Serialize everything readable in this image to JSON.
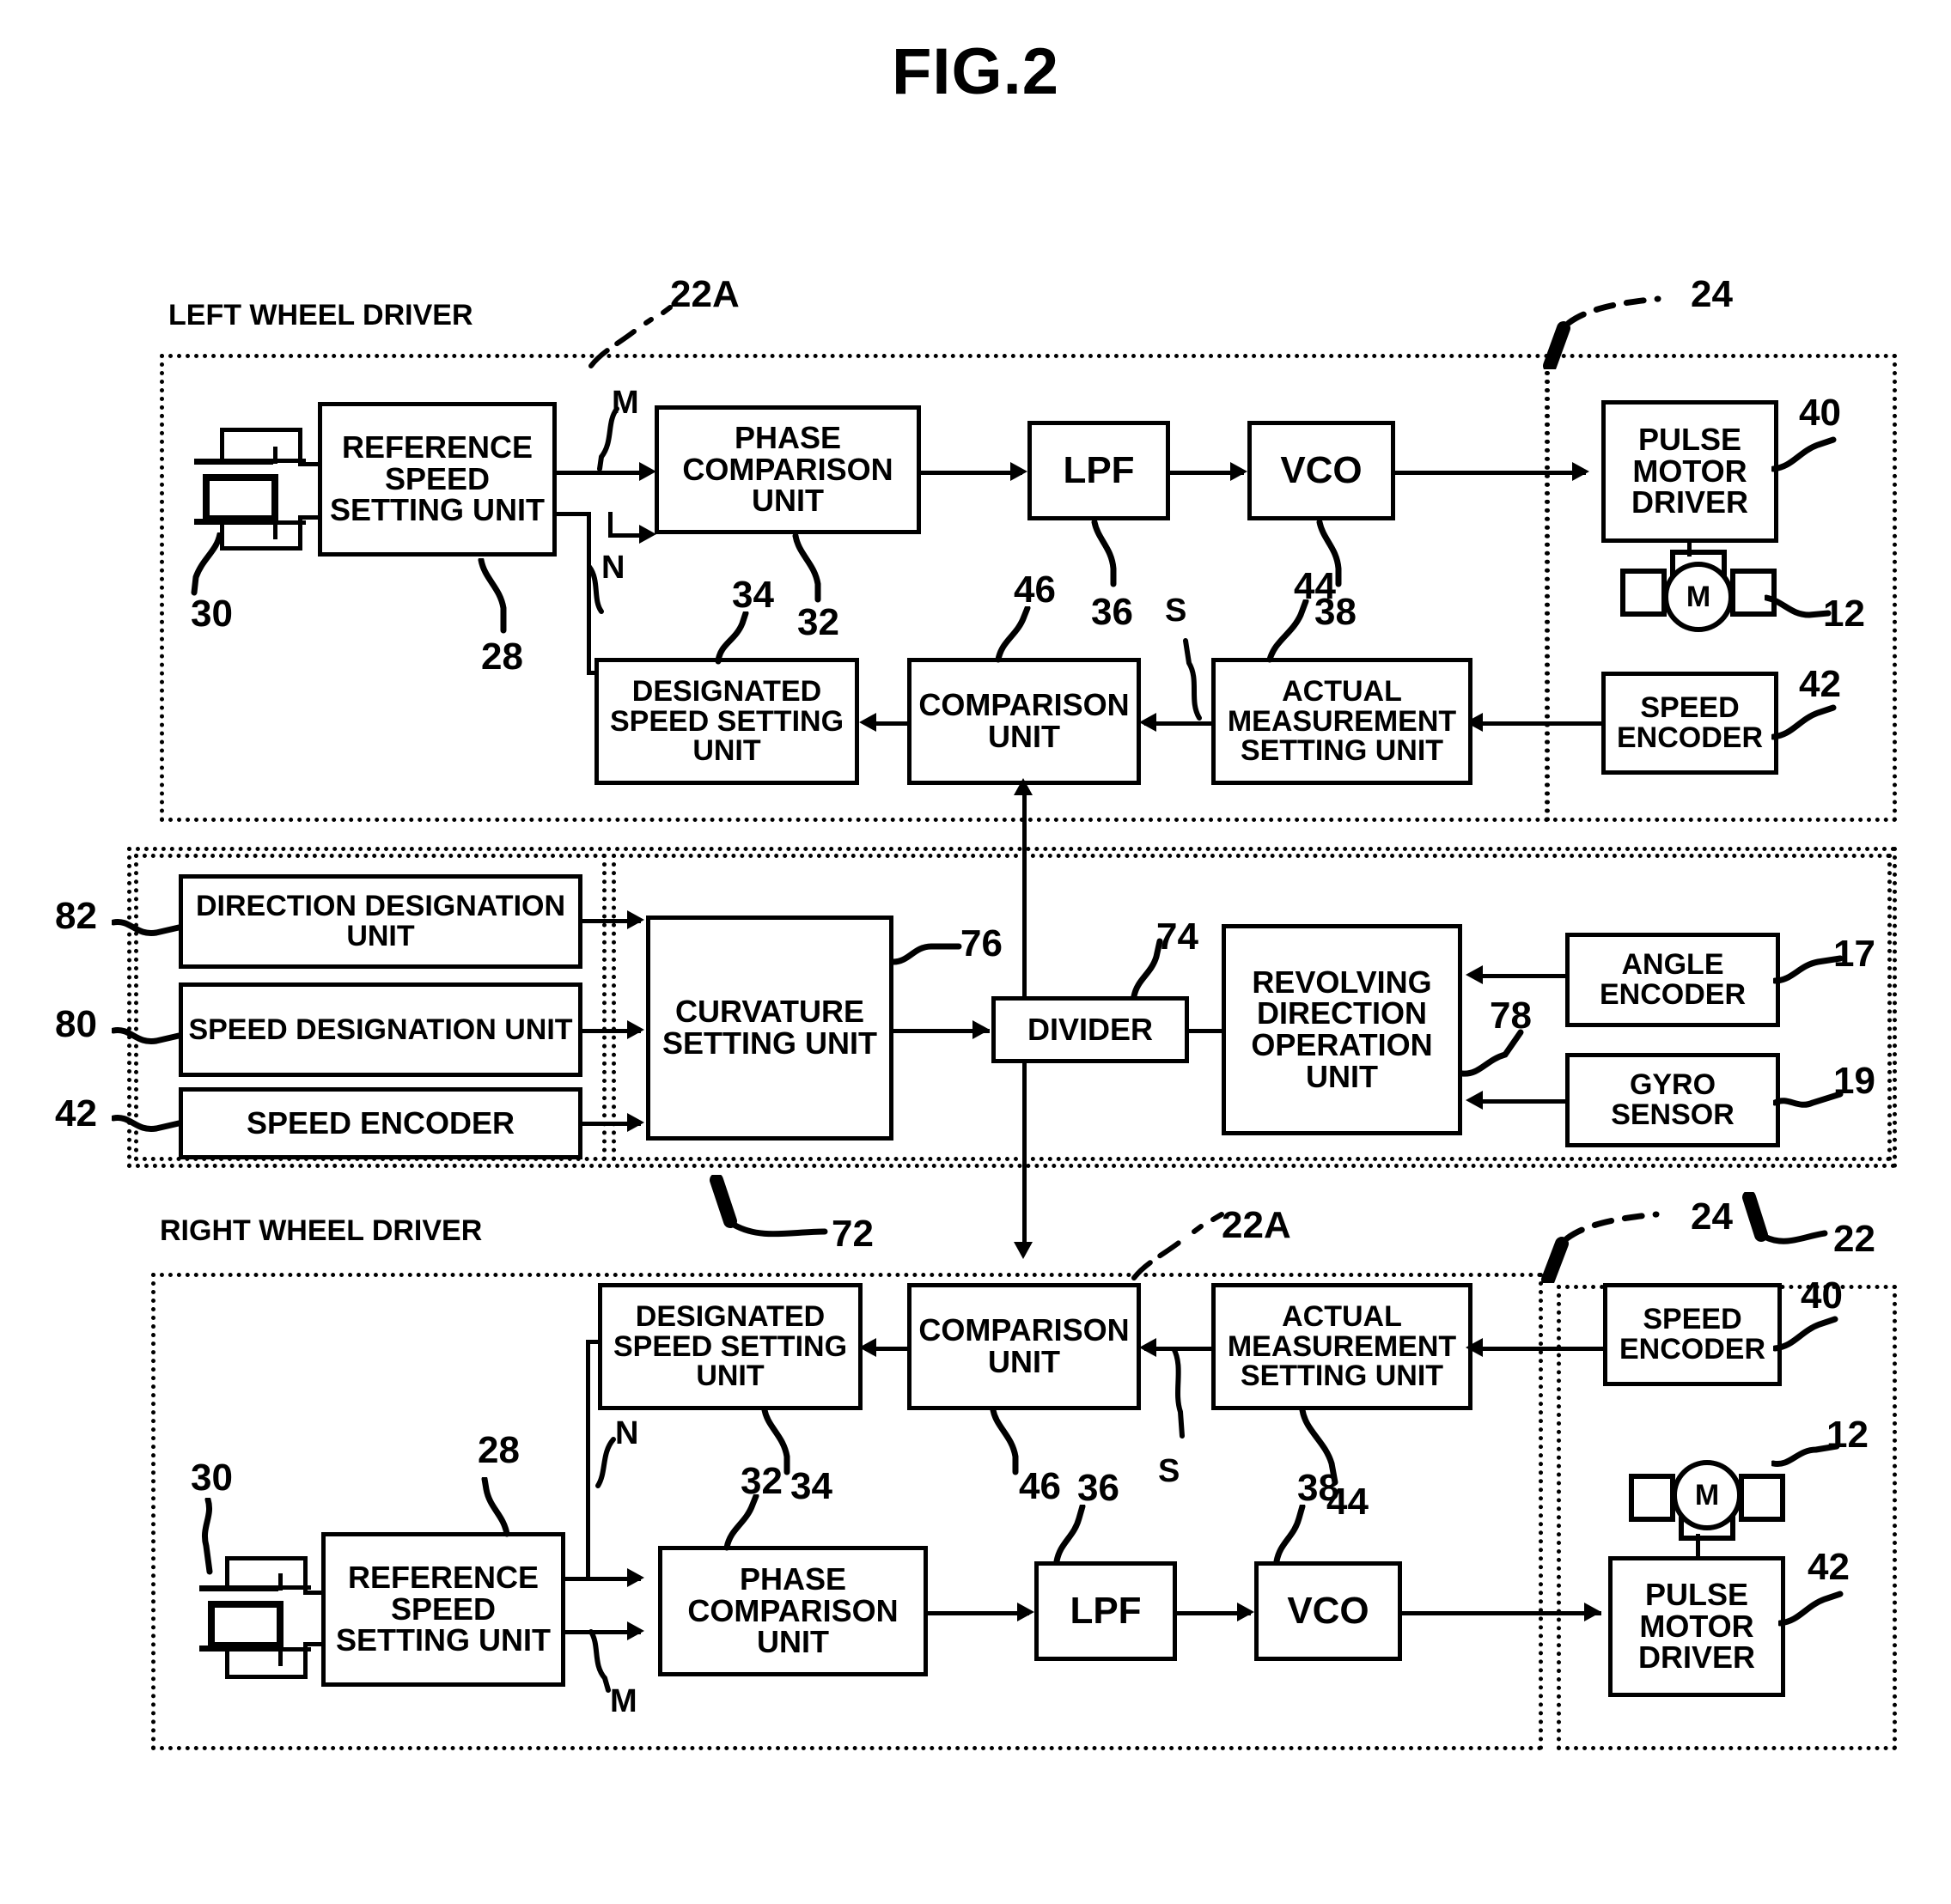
{
  "figure": {
    "title": "FIG.2"
  },
  "regions": {
    "left_driver": {
      "caption": "LEFT WHEEL DRIVER",
      "ref": "22A"
    },
    "right_driver": {
      "caption": "RIGHT WHEEL DRIVER",
      "ref": "22A"
    },
    "motor_unit_top": {
      "ref": "24"
    },
    "motor_unit_bottom": {
      "ref": "24"
    },
    "drive_system": {
      "ref": "22"
    },
    "command_group": {
      "ref": "72"
    }
  },
  "top": {
    "reference_speed_setting_unit": {
      "label": "REFERENCE SPEED SETTING UNIT",
      "ref": "28"
    },
    "oscillator": {
      "ref": "30"
    },
    "phase_comparison_unit": {
      "label": "PHASE COMPARISON UNIT",
      "ref": "32"
    },
    "lpf": {
      "label": "LPF",
      "ref": "36"
    },
    "vco": {
      "label": "VCO",
      "ref": "38"
    },
    "pulse_motor_driver": {
      "label": "PULSE MOTOR DRIVER",
      "ref": "40"
    },
    "motor": {
      "label": "M",
      "ref": "12"
    },
    "speed_encoder": {
      "label": "SPEED ENCODER",
      "ref": "42"
    },
    "designated_speed_setting_unit": {
      "label": "DESIGNATED SPEED SETTING UNIT",
      "ref": "34"
    },
    "comparison_unit": {
      "label": "COMPARISON UNIT",
      "ref": "46"
    },
    "actual_measurement_setting_unit": {
      "label": "ACTUAL MEASUREMENT SETTING UNIT",
      "ref": "44"
    },
    "signal_m": "M",
    "signal_n": "N",
    "signal_s": "S"
  },
  "middle": {
    "direction_designation_unit": {
      "label": "DIRECTION DESIGNATION UNIT",
      "ref": "82"
    },
    "speed_designation_unit": {
      "label": "SPEED DESIGNATION UNIT",
      "ref": "80"
    },
    "speed_encoder": {
      "label": "SPEED ENCODER",
      "ref": "42"
    },
    "curvature_setting_unit": {
      "label": "CURVATURE SETTING UNIT",
      "ref": "76"
    },
    "divider": {
      "label": "DIVIDER",
      "ref": "74"
    },
    "revolving_direction_operation_unit": {
      "label": "REVOLVING DIRECTION OPERATION UNIT",
      "ref": "78"
    },
    "angle_encoder": {
      "label": "ANGLE ENCODER",
      "ref": "17"
    },
    "gyro_sensor": {
      "label": "GYRO SENSOR",
      "ref": "19"
    }
  },
  "bottom": {
    "designated_speed_setting_unit": {
      "label": "DESIGNATED SPEED SETTING UNIT",
      "ref": "34"
    },
    "comparison_unit": {
      "label": "COMPARISON UNIT",
      "ref": "46"
    },
    "actual_measurement_setting_unit": {
      "label": "ACTUAL MEASUREMENT SETTING UNIT",
      "ref": "44"
    },
    "speed_encoder": {
      "label": "SPEED ENCODER",
      "ref": "40"
    },
    "motor": {
      "label": "M",
      "ref": "12"
    },
    "reference_speed_setting_unit": {
      "label": "REFERENCE SPEED SETTING UNIT",
      "ref": "28"
    },
    "oscillator": {
      "ref": "30"
    },
    "phase_comparison_unit": {
      "label": "PHASE COMPARISON UNIT",
      "ref": "32"
    },
    "lpf": {
      "label": "LPF",
      "ref": "36"
    },
    "vco": {
      "label": "VCO",
      "ref": "38"
    },
    "pulse_motor_driver": {
      "label": "PULSE MOTOR DRIVER",
      "ref": "42"
    },
    "signal_m": "M",
    "signal_n": "N",
    "signal_s": "S"
  }
}
